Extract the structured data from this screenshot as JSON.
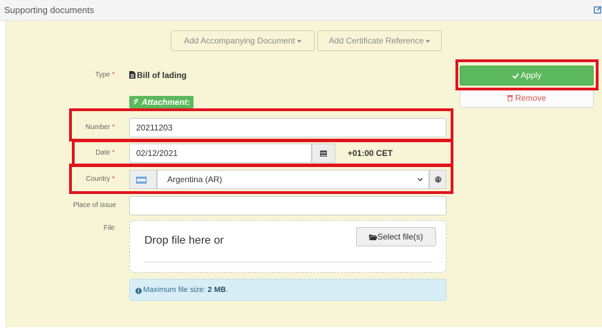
{
  "header": {
    "title": "Supporting documents",
    "edit_icon": "edit-icon"
  },
  "toolbar": {
    "add_accompanying_label": "Add Accompanying Document",
    "add_certificate_label": "Add Certificate Reference"
  },
  "form": {
    "type_label": "Type",
    "type_value": "Bill of lading",
    "attachment_badge": "Attachment:",
    "number_label": "Number",
    "number_value": "20211203",
    "date_label": "Date",
    "date_value": "02/12/2021",
    "timezone": "+01:00 CET",
    "country_label": "Country",
    "country_value": "Argentina (AR)",
    "place_label": "Place of issue",
    "place_value": "",
    "file_label": "File",
    "drop_text": "Drop file here or",
    "select_files_label": "Select file(s)",
    "info_prefix": "Maximum file size:",
    "info_size": "2 MB",
    "required_mark": "*"
  },
  "actions": {
    "apply_label": "Apply",
    "remove_label": "Remove"
  },
  "colors": {
    "panel_bg": "#f7f5d6",
    "apply_green": "#5cb85c",
    "highlight_red": "#e0141e",
    "info_bg": "#d9edf7"
  }
}
